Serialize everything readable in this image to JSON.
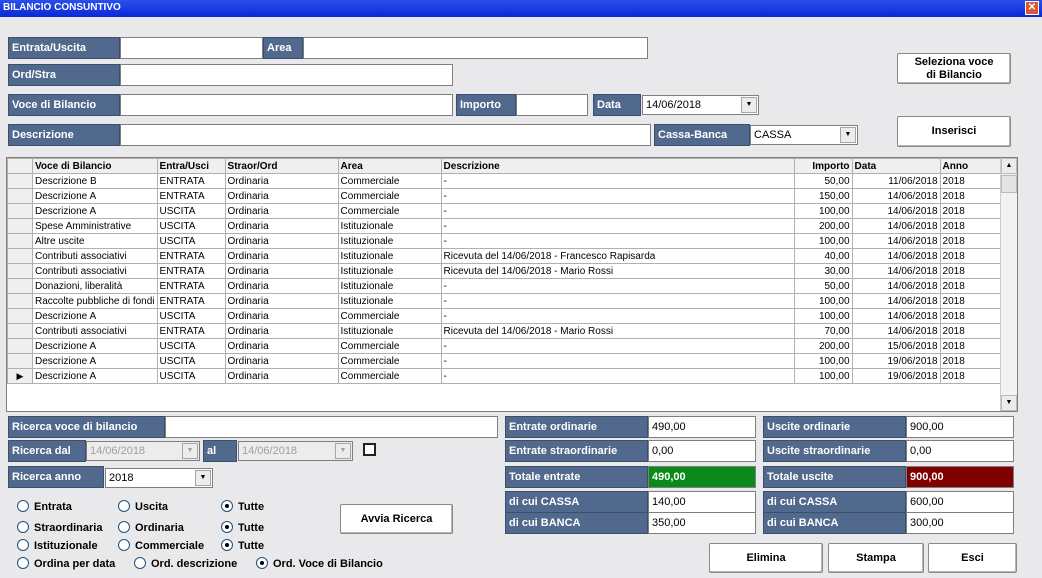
{
  "window": {
    "title": "BILANCIO CONSUNTIVO",
    "close_icon": "close-icon"
  },
  "form": {
    "entrata_uscita_label": "Entrata/Uscita",
    "entrata_uscita_value": "",
    "area_label": "Area",
    "area_value": "",
    "ord_stra_label": "Ord/Stra",
    "ord_stra_value": "",
    "voce_label": "Voce di Bilancio",
    "voce_value": "",
    "importo_label": "Importo",
    "importo_value": "",
    "data_label": "Data",
    "data_value": "14/06/2018",
    "descrizione_label": "Descrizione",
    "descrizione_value": "",
    "cassa_banca_label": "Cassa-Banca",
    "cassa_banca_value": "CASSA"
  },
  "buttons": {
    "seleziona_line1": "Seleziona voce",
    "seleziona_line2": "di Bilancio",
    "inserisci": "Inserisci",
    "avvia": "Avvia Ricerca",
    "elimina": "Elimina",
    "stampa": "Stampa",
    "esci": "Esci"
  },
  "grid": {
    "columns": [
      "",
      "Voce di Bilancio",
      "Entra/Usci",
      "Straor/Ord",
      "Area",
      "Descrizione",
      "Importo",
      "Data",
      "Anno"
    ],
    "rows": [
      [
        "",
        "Descrizione B",
        "ENTRATA",
        "Ordinaria",
        "Commerciale",
        "-",
        "50,00",
        "11/06/2018",
        "2018"
      ],
      [
        "",
        "Descrizione A",
        "ENTRATA",
        "Ordinaria",
        "Commerciale",
        "-",
        "150,00",
        "14/06/2018",
        "2018"
      ],
      [
        "",
        "Descrizione A",
        "USCITA",
        "Ordinaria",
        "Commerciale",
        "-",
        "100,00",
        "14/06/2018",
        "2018"
      ],
      [
        "",
        "Spese Amministrative",
        "USCITA",
        "Ordinaria",
        "Istituzionale",
        "-",
        "200,00",
        "14/06/2018",
        "2018"
      ],
      [
        "",
        "Altre uscite",
        "USCITA",
        "Ordinaria",
        "Istituzionale",
        "-",
        "100,00",
        "14/06/2018",
        "2018"
      ],
      [
        "",
        "Contributi associativi",
        "ENTRATA",
        "Ordinaria",
        "Istituzionale",
        "Ricevuta  del 14/06/2018 - Francesco Rapisarda",
        "40,00",
        "14/06/2018",
        "2018"
      ],
      [
        "",
        "Contributi associativi",
        "ENTRATA",
        "Ordinaria",
        "Istituzionale",
        "Ricevuta  del 14/06/2018 - Mario Rossi",
        "30,00",
        "14/06/2018",
        "2018"
      ],
      [
        "",
        "Donazioni, liberalità",
        "ENTRATA",
        "Ordinaria",
        "Istituzionale",
        "-",
        "50,00",
        "14/06/2018",
        "2018"
      ],
      [
        "",
        "Raccolte pubbliche di fondi",
        "ENTRATA",
        "Ordinaria",
        "Istituzionale",
        "-",
        "100,00",
        "14/06/2018",
        "2018"
      ],
      [
        "",
        "Descrizione A",
        "USCITA",
        "Ordinaria",
        "Commerciale",
        "-",
        "100,00",
        "14/06/2018",
        "2018"
      ],
      [
        "",
        "Contributi associativi",
        "ENTRATA",
        "Ordinaria",
        "Istituzionale",
        "Ricevuta  del 14/06/2018 - Mario Rossi",
        "70,00",
        "14/06/2018",
        "2018"
      ],
      [
        "",
        "Descrizione A",
        "USCITA",
        "Ordinaria",
        "Commerciale",
        "-",
        "200,00",
        "15/06/2018",
        "2018"
      ],
      [
        "",
        "Descrizione A",
        "USCITA",
        "Ordinaria",
        "Commerciale",
        "-",
        "100,00",
        "19/06/2018",
        "2018"
      ],
      [
        "▶",
        "Descrizione A",
        "USCITA",
        "Ordinaria",
        "Commerciale",
        "-",
        "100,00",
        "19/06/2018",
        "2018"
      ]
    ]
  },
  "search": {
    "voce_label": "Ricerca voce di bilancio",
    "voce_value": "",
    "dal_label": "Ricerca dal",
    "dal_value": "14/06/2018",
    "al_label": "al",
    "al_value": "14/06/2018",
    "anno_label": "Ricerca anno",
    "anno_value": "2018"
  },
  "radios": {
    "entrata": "Entrata",
    "uscita": "Uscita",
    "tutte1": "Tutte",
    "straordinaria": "Straordinaria",
    "ordinaria": "Ordinaria",
    "tutte2": "Tutte",
    "istituzionale": "Istituzionale",
    "commerciale": "Commerciale",
    "tutte3": "Tutte",
    "ordina_data": "Ordina per data",
    "ord_descrizione": "Ord. descrizione",
    "ord_voce": "Ord. Voce di Bilancio"
  },
  "totals": {
    "entrate_ordinarie_label": "Entrate ordinarie",
    "entrate_ordinarie": "490,00",
    "entrate_straordinarie_label": "Entrate straordinarie",
    "entrate_straordinarie": "0,00",
    "totale_entrate_label": "Totale entrate",
    "totale_entrate": "490,00",
    "entrate_cassa_label": "di cui CASSA",
    "entrate_cassa": "140,00",
    "entrate_banca_label": "di cui BANCA",
    "entrate_banca": "350,00",
    "uscite_ordinarie_label": "Uscite ordinarie",
    "uscite_ordinarie": "900,00",
    "uscite_straordinarie_label": "Uscite straordinarie",
    "uscite_straordinarie": "0,00",
    "totale_uscite_label": "Totale uscite",
    "totale_uscite": "900,00",
    "uscite_cassa_label": "di cui CASSA",
    "uscite_cassa": "600,00",
    "uscite_banca_label": "di cui BANCA",
    "uscite_banca": "300,00"
  },
  "colors": {
    "label_bg": "#51698d",
    "entrate_total": "#0a8a1a",
    "uscite_total": "#800000"
  }
}
